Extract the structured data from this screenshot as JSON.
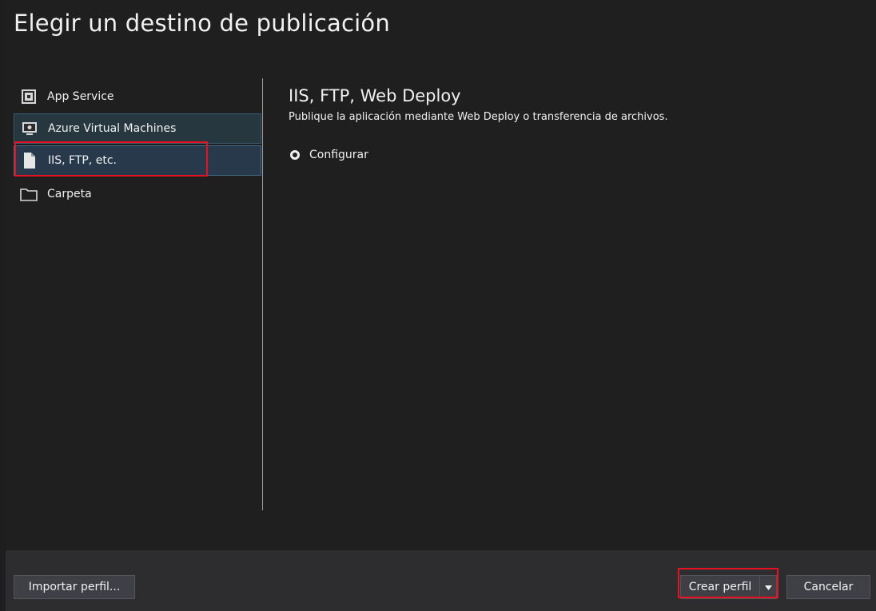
{
  "dialog": {
    "title": "Elegir un destino de publicación"
  },
  "sidebar": {
    "items": [
      {
        "label": "App Service",
        "icon": "app-service-icon"
      },
      {
        "label": "Azure Virtual Machines",
        "icon": "virtual-machine-icon"
      },
      {
        "label": "IIS, FTP, etc.",
        "icon": "document-icon"
      },
      {
        "label": "Carpeta",
        "icon": "folder-icon"
      }
    ],
    "selected_index": 2
  },
  "detail": {
    "title": "IIS, FTP, Web Deploy",
    "description": "Publique la aplicación mediante Web Deploy o transferencia de archivos.",
    "option_label": "Configurar"
  },
  "footer": {
    "import_label": "Importar perfil...",
    "create_label": "Crear perfil",
    "cancel_label": "Cancelar"
  },
  "colors": {
    "background": "#1f1f1f",
    "footer": "#2d2d30",
    "selected": "#27394a",
    "highlight": "#e81123"
  }
}
